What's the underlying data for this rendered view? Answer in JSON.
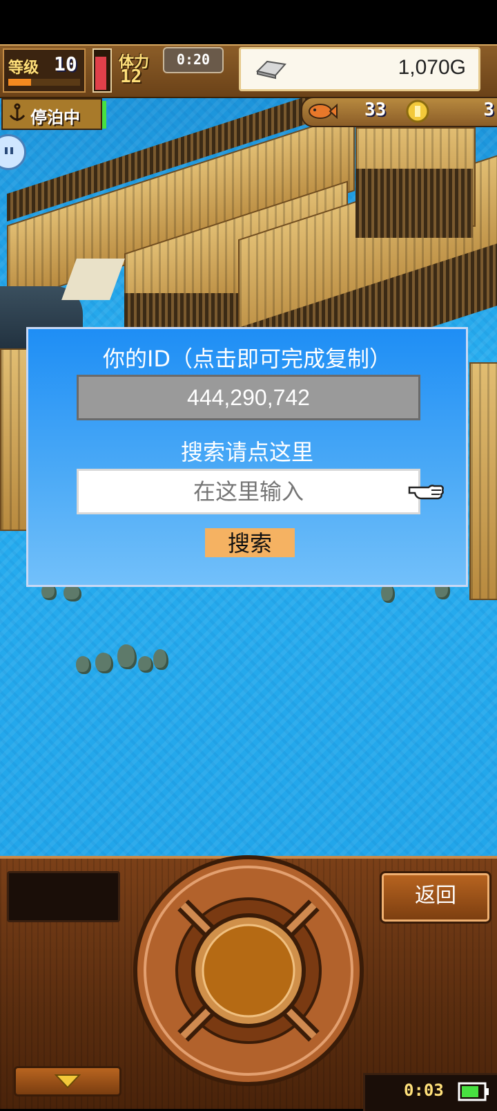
{
  "hud": {
    "level_label": "等级",
    "level_value": "10",
    "stamina_label": "体力",
    "stamina_value": "12",
    "timer": "0:20",
    "gold": "1,070G",
    "status_label": "停泊中",
    "item_count": "33",
    "coin_count": "3"
  },
  "dialog": {
    "id_label": "你的ID（点击即可完成复制）",
    "id_value": "444,290,742",
    "search_label": "搜索请点这里",
    "input_placeholder": "在这里输入",
    "search_button": "搜索"
  },
  "console": {
    "back_button": "返回",
    "clock": "0:03"
  },
  "icons": [
    "anchor-icon",
    "silver-bar-icon",
    "fish-icon",
    "gold-coin-icon",
    "pointing-hand-icon",
    "triangle-down-icon",
    "battery-icon",
    "chat-bubble-icon",
    "helm-wheel-icon"
  ],
  "colors": {
    "dialog_blue": "#1e8ef5",
    "id_box_gray": "#9a9a9a",
    "search_button": "#f5b262",
    "wood": "#7b4018"
  }
}
